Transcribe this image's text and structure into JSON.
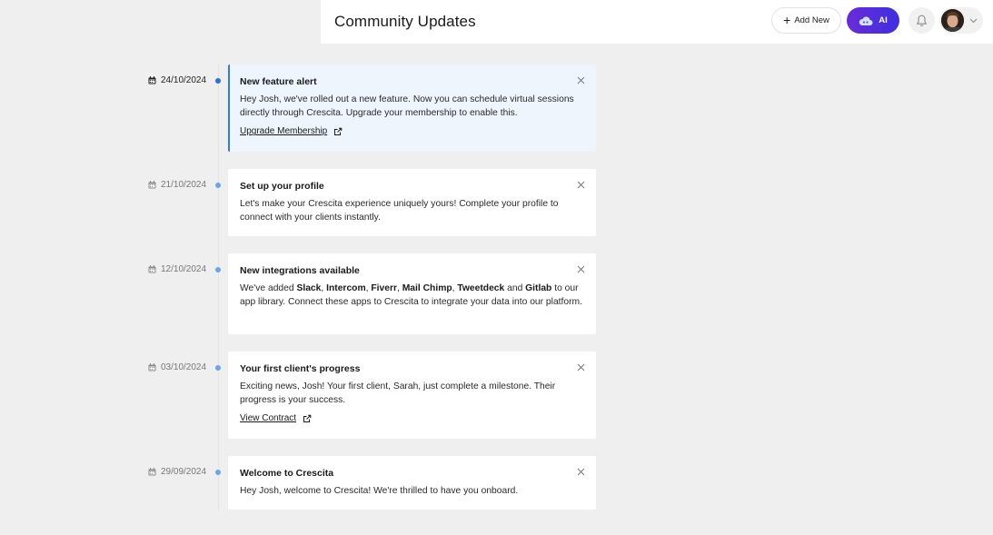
{
  "header": {
    "title": "Community Updates",
    "add_new_label": "Add New",
    "ai_label": "AI"
  },
  "colors": {
    "accent": "#2f7ce0",
    "ai_gradient_start": "#6a2bd9",
    "ai_gradient_end": "#3d2fe0",
    "highlight_bg": "#eef5fd"
  },
  "updates": [
    {
      "date": "24/10/2024",
      "title": "New feature alert",
      "body": "Hey Josh, we've rolled out a new feature. Now you can schedule virtual sessions directly through Crescita. Upgrade your membership to enable this.",
      "link": "Upgrade Membership",
      "highlighted": true
    },
    {
      "date": "21/10/2024",
      "title": "Set up your profile",
      "body": "Let's make your Crescita experience uniquely yours! Complete your profile to connect with your clients instantly."
    },
    {
      "date": "12/10/2024",
      "title": "New integrations available",
      "body_parts": {
        "prefix": "We've added ",
        "apps": [
          "Slack",
          "Intercom",
          "Fiverr",
          "Mail Chimp",
          "Tweetdeck",
          "Gitlab"
        ],
        "sep_comma": ", ",
        "sep_and": " and ",
        "suffix": " to our app library. Connect these apps to Crescita to integrate your data into our platform."
      }
    },
    {
      "date": "03/10/2024",
      "title": "Your first client's progress",
      "body": "Exciting news, Josh! Your first client, Sarah, just complete a milestone. Their progress is your success.",
      "link": "View Contract"
    },
    {
      "date": "29/09/2024",
      "title": "Welcome to Crescita",
      "body": "Hey Josh, welcome to Crescita! We're thrilled to have you onboard."
    }
  ],
  "icons": {
    "calendar": "calendar-icon",
    "close": "close-icon",
    "external_link": "external-link-icon",
    "bell": "bell-icon",
    "chevron": "chevron-down-icon",
    "plus": "plus-icon",
    "ai": "ai-cloud-icon"
  }
}
